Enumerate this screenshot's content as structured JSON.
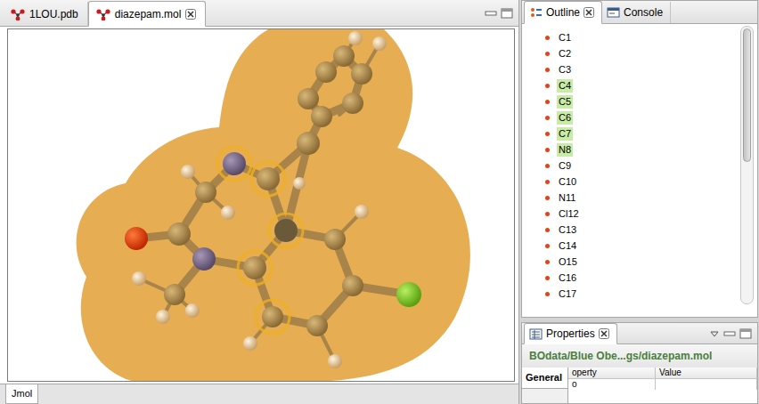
{
  "editor": {
    "tabs": [
      {
        "label": "1LOU.pdb",
        "selected": false,
        "closable": false
      },
      {
        "label": "diazepam.mol",
        "selected": true,
        "closable": true
      }
    ],
    "bottom_tabs": [
      {
        "label": "Jmol",
        "selected": true
      }
    ]
  },
  "outline": {
    "tabs": [
      {
        "label": "Outline",
        "selected": true,
        "closable": true
      },
      {
        "label": "Console",
        "selected": false,
        "closable": false
      }
    ],
    "items": [
      {
        "label": "C1",
        "selected": false
      },
      {
        "label": "C2",
        "selected": false
      },
      {
        "label": "C3",
        "selected": false
      },
      {
        "label": "C4",
        "selected": true
      },
      {
        "label": "C5",
        "selected": true
      },
      {
        "label": "C6",
        "selected": true
      },
      {
        "label": "C7",
        "selected": true
      },
      {
        "label": "N8",
        "selected": true
      },
      {
        "label": "C9",
        "selected": false
      },
      {
        "label": "C10",
        "selected": false
      },
      {
        "label": "N11",
        "selected": false
      },
      {
        "label": "Cl12",
        "selected": false
      },
      {
        "label": "C13",
        "selected": false
      },
      {
        "label": "C14",
        "selected": false
      },
      {
        "label": "O15",
        "selected": false
      },
      {
        "label": "C16",
        "selected": false
      },
      {
        "label": "C17",
        "selected": false
      }
    ]
  },
  "properties": {
    "tab": "Properties",
    "path": "BOdata/Blue Obe...gs/diazepam.mol",
    "side_tabs": [
      {
        "label": "General",
        "selected": true
      }
    ],
    "columns": [
      "operty",
      "Value"
    ],
    "rows": [
      [
        "o",
        ""
      ]
    ]
  }
}
